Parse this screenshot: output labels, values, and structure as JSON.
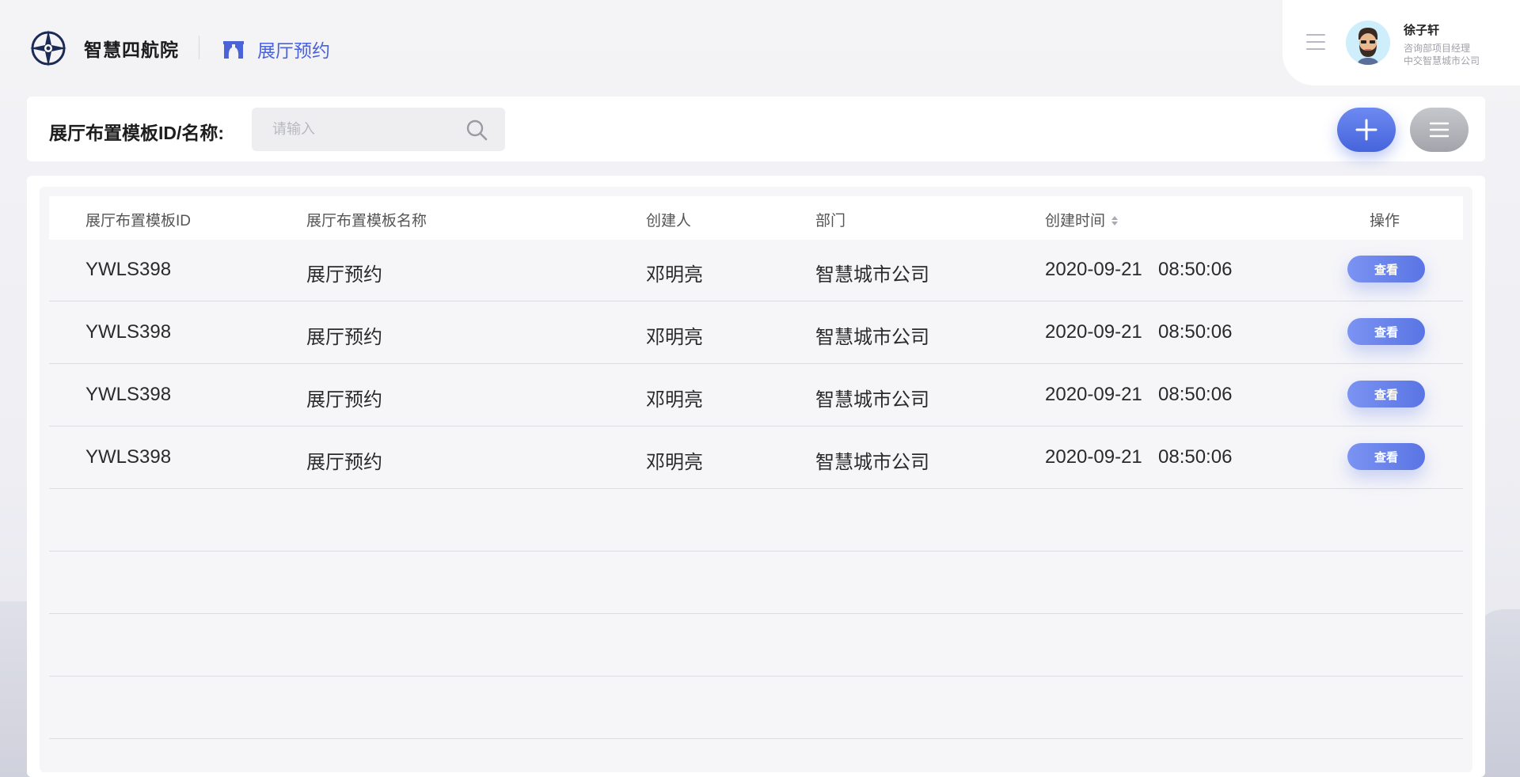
{
  "header": {
    "brand": "智慧四航院",
    "page_title": "展厅预约"
  },
  "user": {
    "name": "徐子轩",
    "role": "咨询部项目经理",
    "org": "中交智慧城市公司"
  },
  "search": {
    "label": "展厅布置模板ID/名称:",
    "placeholder": "请输入",
    "value": ""
  },
  "table": {
    "columns": {
      "id": "展厅布置模板ID",
      "name": "展厅布置模板名称",
      "creator": "创建人",
      "dept": "部门",
      "time": "创建时间",
      "action": "操作"
    },
    "rows": [
      {
        "id": "YWLS398",
        "name": "展厅预约",
        "creator": "邓明亮",
        "dept": "智慧城市公司",
        "date": "2020-09-21",
        "time": "08:50:06",
        "action": "查看"
      },
      {
        "id": "YWLS398",
        "name": "展厅预约",
        "creator": "邓明亮",
        "dept": "智慧城市公司",
        "date": "2020-09-21",
        "time": "08:50:06",
        "action": "查看"
      },
      {
        "id": "YWLS398",
        "name": "展厅预约",
        "creator": "邓明亮",
        "dept": "智慧城市公司",
        "date": "2020-09-21",
        "time": "08:50:06",
        "action": "查看"
      },
      {
        "id": "YWLS398",
        "name": "展厅预约",
        "creator": "邓明亮",
        "dept": "智慧城市公司",
        "date": "2020-09-21",
        "time": "08:50:06",
        "action": "查看"
      }
    ]
  },
  "icons": {
    "logo": "company-logo",
    "page": "exhibition-hall-icon",
    "menu": "menu-icon",
    "search": "search-icon",
    "add": "plus-icon",
    "filter": "list-icon",
    "sort": "sort-icon"
  },
  "colors": {
    "accent": "#4b63d8",
    "button_gradient_start": "#7b93f2",
    "button_gradient_end": "#5a75e4"
  }
}
